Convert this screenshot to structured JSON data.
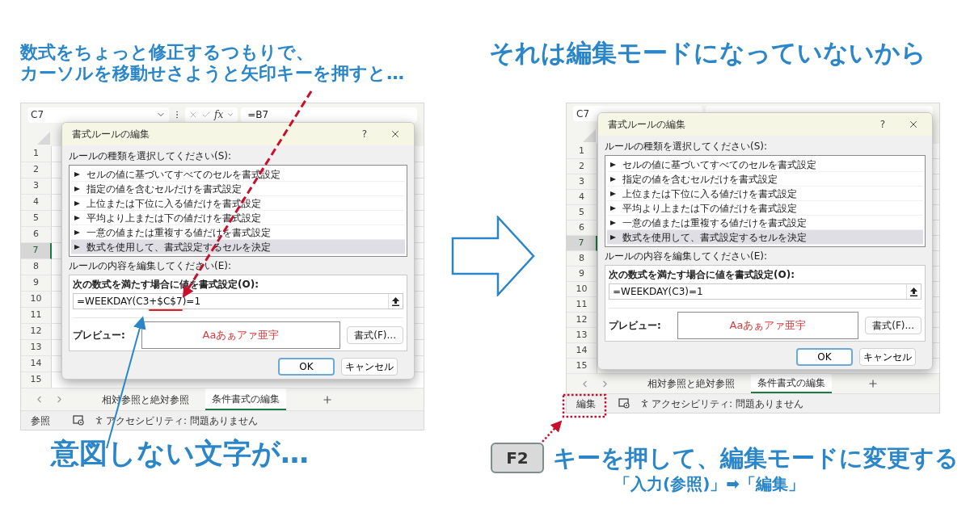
{
  "left": {
    "heading_lines": [
      "数式をちょっと修正するつもりで、",
      "カーソルを移動せさようと矢印キーを押すと…"
    ],
    "excel": {
      "name_box": "C7",
      "fx": "fx",
      "formula": "=B7",
      "rows": [
        {
          "label": "1",
          "selected": false
        },
        {
          "label": "2",
          "selected": false
        },
        {
          "label": "3",
          "selected": false
        },
        {
          "label": "4",
          "selected": false
        },
        {
          "label": "5",
          "selected": false
        },
        {
          "label": "6",
          "selected": false
        },
        {
          "label": "7",
          "selected": true
        },
        {
          "label": "8",
          "selected": false
        },
        {
          "label": "9",
          "selected": false
        },
        {
          "label": "10",
          "selected": false
        },
        {
          "label": "11",
          "selected": false
        },
        {
          "label": "12",
          "selected": false
        },
        {
          "label": "13",
          "selected": false
        },
        {
          "label": "14",
          "selected": false
        },
        {
          "label": "15",
          "selected": false
        }
      ],
      "dialog": {
        "title": "書式ルールの編集",
        "help": "?",
        "rule_type_label": "ルールの種類を選択してください(S):",
        "rule_types": [
          {
            "label": "セルの値に基づいてすべてのセルを書式設定",
            "selected": false
          },
          {
            "label": "指定の値を含むセルだけを書式設定",
            "selected": false
          },
          {
            "label": "上位または下位に入る値だけを書式設定",
            "selected": false
          },
          {
            "label": "平均より上または下の値だけを書式設定",
            "selected": false
          },
          {
            "label": "一意の値または重複する値だけを書式設定",
            "selected": false
          },
          {
            "label": "数式を使用して、書式設定するセルを決定",
            "selected": true
          }
        ],
        "edit_label": "ルールの内容を編集してください(E):",
        "condition_label": "次の数式を満たす場合に値を書式設定(O):",
        "formula_parts": [
          {
            "text": "=WEEKDAY(C3",
            "kind": "plain"
          },
          {
            "text": "+$C$7",
            "kind": "unintended"
          },
          {
            "text": ")=1",
            "kind": "plain"
          }
        ],
        "preview_label": "プレビュー:",
        "preview_text": "Aaあぁアァ亜宇",
        "format_button": "書式(F)...",
        "ok": "OK",
        "cancel": "キャンセル"
      },
      "sheet_tabs": [
        {
          "label": "相対参照と絶対参照",
          "selected": false
        },
        {
          "label": "条件書式の編集",
          "selected": true
        }
      ],
      "status_mode": "参照",
      "accessibility": "アクセシビリティ: 問題ありません"
    },
    "caption": "意図しない文字が…"
  },
  "right": {
    "heading": "それは編集モードになっていないから",
    "excel": {
      "name_box": "C7",
      "rows": [
        {
          "label": "1",
          "selected": false
        },
        {
          "label": "2",
          "selected": false
        },
        {
          "label": "3",
          "selected": false
        },
        {
          "label": "4",
          "selected": false
        },
        {
          "label": "5",
          "selected": false
        },
        {
          "label": "6",
          "selected": false
        },
        {
          "label": "7",
          "selected": true
        },
        {
          "label": "8",
          "selected": false
        },
        {
          "label": "9",
          "selected": false
        },
        {
          "label": "10",
          "selected": false
        },
        {
          "label": "11",
          "selected": false
        },
        {
          "label": "12",
          "selected": false
        },
        {
          "label": "13",
          "selected": false
        },
        {
          "label": "14",
          "selected": false
        },
        {
          "label": "15",
          "selected": false
        }
      ],
      "dialog": {
        "title": "書式ルールの編集",
        "help": "?",
        "rule_type_label": "ルールの種類を選択してください(S):",
        "rule_types": [
          {
            "label": "セルの値に基づいてすべてのセルを書式設定",
            "selected": false
          },
          {
            "label": "指定の値を含むセルだけを書式設定",
            "selected": false
          },
          {
            "label": "上位または下位に入る値だけを書式設定",
            "selected": false
          },
          {
            "label": "平均より上または下の値だけを書式設定",
            "selected": false
          },
          {
            "label": "一意の値または重複する値だけを書式設定",
            "selected": false
          },
          {
            "label": "数式を使用して、書式設定するセルを決定",
            "selected": true
          }
        ],
        "edit_label": "ルールの内容を編集してください(E):",
        "condition_label": "次の数式を満たす場合に値を書式設定(O):",
        "formula_parts": [
          {
            "text": "=WEEKDAY(C3)=1",
            "kind": "plain"
          }
        ],
        "preview_label": "プレビュー:",
        "preview_text": "Aaあぁアァ亜宇",
        "format_button": "書式(F)...",
        "ok": "OK",
        "cancel": "キャンセル"
      },
      "sheet_tabs": [
        {
          "label": "相対参照と絶対参照",
          "selected": false
        },
        {
          "label": "条件書式の編集",
          "selected": true
        }
      ],
      "status_mode": "編集",
      "accessibility": "アクセシビリティ: 問題ありません"
    },
    "key": "F2",
    "caption": "キーを押して、編集モードに変更する",
    "subcaption": "「入力(参照)」➡「編集」"
  }
}
